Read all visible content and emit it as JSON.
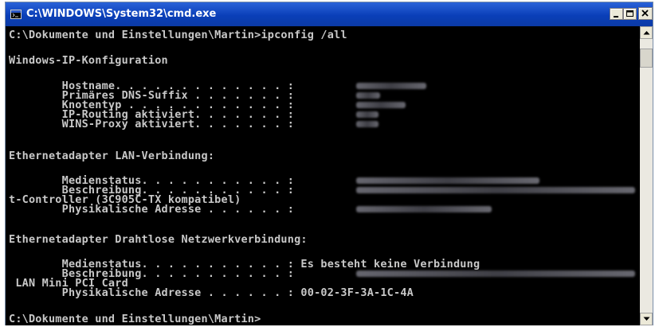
{
  "window": {
    "title": "C:\\WINDOWS\\System32\\cmd.exe",
    "icon": "cmd-icon",
    "controls": [
      "minimize-icon",
      "maximize-icon",
      "close-icon"
    ]
  },
  "console": {
    "lines": [
      "C:\\Dokumente und Einstellungen\\Martin>ipconfig /all",
      "Windows-IP-Konfiguration",
      "        Hostname. . . . . . . . . . . . . :",
      "        Primäres DNS-Suffix . . . . . . . :",
      "        Knotentyp . . . . . . . . . . . . :",
      "        IP-Routing aktiviert. . . . . . . :",
      "        WINS-Proxy aktiviert. . . . . . . :",
      "Ethernetadapter LAN-Verbindung:",
      "        Medienstatus. . . . . . . . . . . :",
      "        Beschreibung. . . . . . . . . . . :",
      "t-Controller (3C905C-TX kompatibel)",
      "        Physikalische Adresse . . . . . . :",
      "Ethernetadapter Drahtlose Netzwerkverbindung:",
      "        Medienstatus. . . . . . . . . . . : Es besteht keine Verbindung",
      "        Beschreibung. . . . . . . . . . . :",
      " LAN Mini PCI Card",
      "        Physikalische Adresse . . . . . . : 00-02-3F-3A-1C-4A",
      "C:\\Dokumente und Einstellungen\\Martin>"
    ]
  },
  "colors": {
    "console_background": "#000000",
    "console_text": "#c0c0c0",
    "titlebar": "#0a3fb8"
  }
}
